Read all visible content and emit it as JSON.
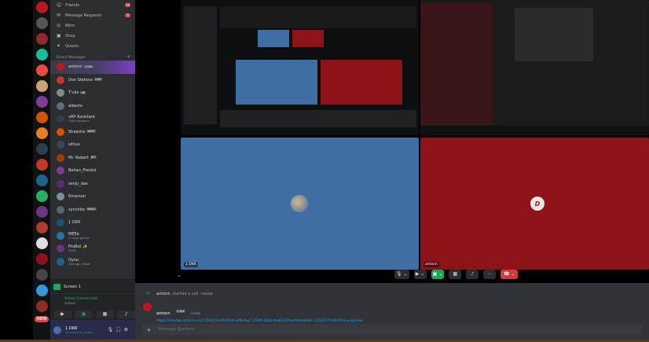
{
  "nav": [
    {
      "icon": "friends-icon",
      "glyph": "☺",
      "label": "Friends",
      "badge": "10"
    },
    {
      "icon": "message-requests-icon",
      "glyph": "✉",
      "label": "Message Requests",
      "badge": "3"
    },
    {
      "icon": "nitro-icon",
      "glyph": "◎",
      "label": "Nitro",
      "badge": ""
    },
    {
      "icon": "shop-icon",
      "glyph": "▣",
      "label": "Shop",
      "badge": ""
    },
    {
      "icon": "quests-icon",
      "glyph": "✦",
      "label": "Quests",
      "badge": ""
    }
  ],
  "dm_header": "Direct Messages",
  "dms": [
    {
      "name": "antonn",
      "tag": "CODE",
      "sub": "",
      "color": "#b8191e",
      "active": true
    },
    {
      "name": "Don Stefano",
      "tag": "DON",
      "sub": "",
      "color": "#c0392b",
      "active": false
    },
    {
      "name": "T'uko",
      "tag": "AR",
      "sub": "",
      "color": "#7f8c8d",
      "active": false
    },
    {
      "name": "alberto",
      "tag": "",
      "sub": "",
      "color": "#5d6d7e",
      "active": false
    },
    {
      "name": "vRP Assistant",
      "tag": "",
      "sub": "1086 members",
      "color": "#2c3e50",
      "active": false
    },
    {
      "name": "Shawma",
      "tag": "DEEP",
      "sub": "",
      "color": "#d35400",
      "active": false
    },
    {
      "name": "sithus",
      "tag": "",
      "sub": "",
      "color": "#34495e",
      "active": false
    },
    {
      "name": "Mr. Robert",
      "tag": "DIT",
      "sub": "",
      "color": "#a04000",
      "active": false
    },
    {
      "name": "Bohan_Prestol",
      "tag": "",
      "sub": "",
      "color": "#7d3c98",
      "active": false
    },
    {
      "name": "senju_das",
      "tag": "",
      "sub": "",
      "color": "#5b2c6f",
      "active": false
    },
    {
      "name": "Emanuel",
      "tag": "",
      "sub": "",
      "color": "#808b96",
      "active": false
    },
    {
      "name": "synchite",
      "tag": "SMILE",
      "sub": "",
      "color": "#566573",
      "active": false
    },
    {
      "name": "1 DKR",
      "tag": "",
      "sub": "",
      "color": "#1a5276",
      "active": false
    },
    {
      "name": "MEEe",
      "tag": "",
      "sub": "2 music games",
      "color": "#2874a6",
      "active": false
    },
    {
      "name": "ProBot ✨",
      "tag": "",
      "sub": "Prefix",
      "color": "#6c3483",
      "active": false
    },
    {
      "name": "Dyno",
      "tag": "",
      "sub": "dyno.gg | Tower",
      "color": "#1f618d",
      "active": false
    }
  ],
  "server_new_label": "NEW",
  "screen_share": {
    "label": "Screen 1"
  },
  "voice": {
    "status": "Voice Connected",
    "channel": "antonn"
  },
  "user": {
    "name": "1 DKR",
    "status": "Sharing their screen"
  },
  "tiles": {
    "t3_label": "1 DKR",
    "t4_label": "antonn",
    "logo_glyph": "D"
  },
  "chat": {
    "system_author": "antonn",
    "system_text": "started a call. narew",
    "author": "antonn",
    "author_tag": "CODE",
    "time": "narew",
    "link": "https://shedge.antonn.co/1159151fe0b0f44-e2fbdaa7-25f4f-4b81-9ab0-205ad9ddeb382-1159151fe0b0f44.png/view",
    "placeholder": "Message @antonn"
  },
  "colors": {
    "accent": "#5865f2",
    "green": "#23a559",
    "red": "#da373c",
    "tile_blue": "#3f6ea5",
    "tile_red": "#8e1318"
  }
}
